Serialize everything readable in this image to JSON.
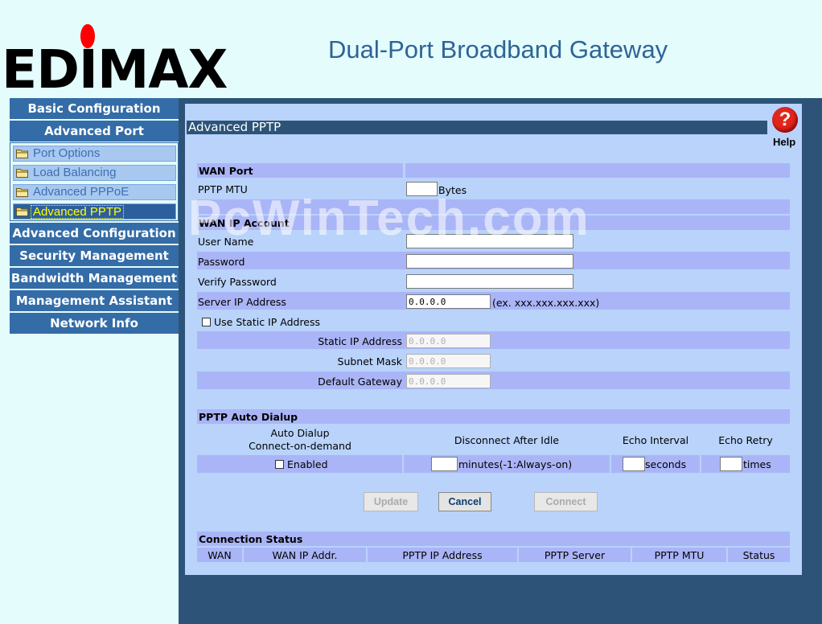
{
  "header": {
    "logo_text": "EDIMAX",
    "product_title": "Dual-Port Broadband Gateway"
  },
  "sidebar": {
    "nav_top": [
      {
        "label": "Basic Configuration"
      },
      {
        "label": "Advanced Port"
      }
    ],
    "sub_items": [
      {
        "label": "Port Options"
      },
      {
        "label": "Load Balancing"
      },
      {
        "label": "Advanced PPPoE"
      },
      {
        "label": "Advanced PPTP"
      }
    ],
    "nav_bottom": [
      {
        "label": "Advanced Configuration"
      },
      {
        "label": "Security Management"
      },
      {
        "label": "Bandwidth Management"
      },
      {
        "label": "Management Assistant"
      },
      {
        "label": "Network Info"
      }
    ]
  },
  "page": {
    "title": "Advanced PPTP",
    "help_label": "Help",
    "watermark": "PcWinTech.com"
  },
  "wan_port": {
    "heading": "WAN Port",
    "mtu_label": "PPTP MTU",
    "mtu_value": "",
    "mtu_unit": "Bytes"
  },
  "wan_ip_account": {
    "heading": "WAN IP Account",
    "username_label": "User Name",
    "username_value": "",
    "password_label": "Password",
    "password_value": "",
    "verify_label": "Verify Password",
    "verify_value": "",
    "server_ip_label": "Server IP Address",
    "server_ip_value": "0.0.0.0",
    "server_ip_hint": "(ex. xxx.xxx.xxx.xxx)",
    "use_static_label": "Use Static IP Address",
    "static_ip_label": "Static IP Address",
    "static_ip_value": "0.0.0.0",
    "subnet_label": "Subnet Mask",
    "subnet_value": "0.0.0.0",
    "gateway_label": "Default Gateway",
    "gateway_value": "0.0.0.0"
  },
  "auto_dialup": {
    "heading": "PPTP Auto Dialup",
    "col_auto_line1": "Auto Dialup",
    "col_auto_line2": "Connect-on-demand",
    "col_idle": "Disconnect After Idle",
    "col_echo_interval": "Echo Interval",
    "col_echo_retry": "Echo Retry",
    "enabled_label": "Enabled",
    "idle_value": "",
    "idle_unit": "minutes(-1:Always-on)",
    "interval_value": "",
    "interval_unit": "seconds",
    "retry_value": "",
    "retry_unit": "times"
  },
  "buttons": {
    "update": "Update",
    "cancel": "Cancel",
    "connect": "Connect"
  },
  "connection_status": {
    "heading": "Connection Status",
    "columns": [
      "WAN",
      "WAN IP Addr.",
      "PPTP IP Address",
      "PPTP Server",
      "PPTP MTU",
      "Status"
    ]
  },
  "colors": {
    "nav_blue": "#336ca7",
    "panel_bg": "#b9d3fb",
    "row_bar": "#aab5f7",
    "dark_bg": "#2d5478",
    "title_blue": "#2e6496",
    "logo_dot": "#ff0000",
    "help_red": "#e1261c"
  },
  "icons": {
    "folder": "folder-icon",
    "help": "help-question-icon"
  }
}
